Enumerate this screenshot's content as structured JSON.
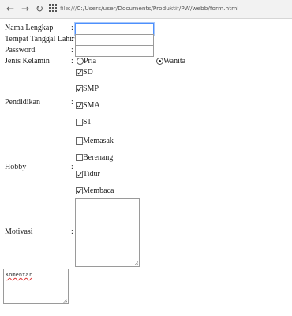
{
  "browser": {
    "url_prefix": "file:///",
    "url_path": "C:/Users/user/Documents/Produktif/PW/webb/form.html"
  },
  "form": {
    "nama": {
      "label": "Nama Lengkap",
      "value": ""
    },
    "ttl": {
      "label": "Tempat Tanggal Lahir",
      "value": ""
    },
    "password": {
      "label": "Password",
      "value": ""
    },
    "gender": {
      "label": "Jenis Kelamin",
      "options": [
        {
          "label": "Pria",
          "selected": false
        },
        {
          "label": "Wanita",
          "selected": true
        }
      ]
    },
    "pendidikan": {
      "label": "Pendidikan",
      "options": [
        {
          "label": "SD",
          "checked": true
        },
        {
          "label": "SMP",
          "checked": true
        },
        {
          "label": "SMA",
          "checked": true
        },
        {
          "label": "S1",
          "checked": false
        }
      ]
    },
    "hobby": {
      "label": "Hobby",
      "options": [
        {
          "label": "Memasak",
          "checked": false
        },
        {
          "label": "Berenang",
          "checked": false
        },
        {
          "label": "Tidur",
          "checked": true
        },
        {
          "label": "Membaca",
          "checked": true
        }
      ]
    },
    "motivasi": {
      "label": "Motivasi",
      "value": ""
    },
    "komentar": {
      "value": "Komentar"
    },
    "colon": ":"
  }
}
